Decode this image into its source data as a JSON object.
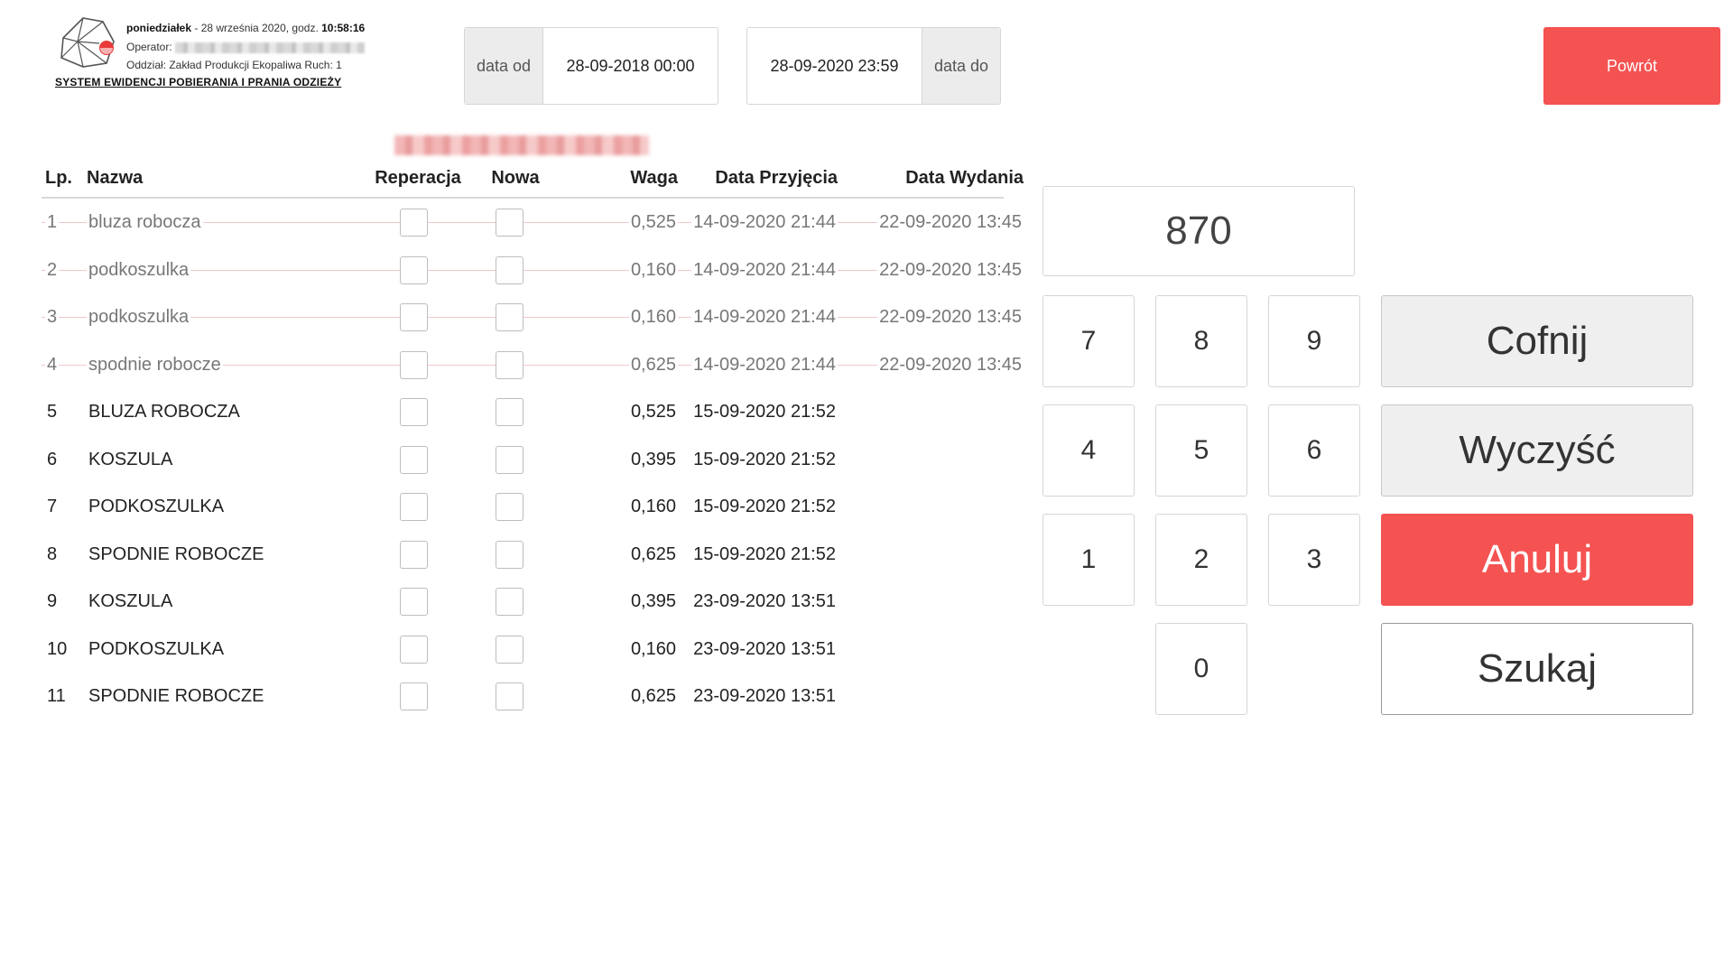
{
  "header": {
    "day": "poniedziałek",
    "date_text": " - 28 września 2020, godz. ",
    "time": "10:58:16",
    "operator_label": "Operator:",
    "branch_text": "Oddział: Zakład Produkcji Ekopaliwa Ruch: 1",
    "system_title": "SYSTEM EWIDENCJI POBIERANIA I PRANIA ODZIEŻY"
  },
  "filters": {
    "from_label": "data od",
    "from_value": "28-09-2018 00:00",
    "to_value": "28-09-2020 23:59",
    "to_label": "data do"
  },
  "back_button": "Powrót",
  "table": {
    "headers": {
      "lp": "Lp.",
      "name": "Nazwa",
      "repair": "Reperacja",
      "new": "Nowa",
      "weight": "Waga",
      "received": "Data Przyjęcia",
      "issued": "Data Wydania"
    },
    "rows": [
      {
        "lp": "1",
        "name": "bluza robocza",
        "weight": "0,525",
        "received": "14-09-2020 21:44",
        "issued": "22-09-2020 13:45"
      },
      {
        "lp": "2",
        "name": "podkoszulka",
        "weight": "0,160",
        "received": "14-09-2020 21:44",
        "issued": "22-09-2020 13:45"
      },
      {
        "lp": "3",
        "name": "podkoszulka",
        "weight": "0,160",
        "received": "14-09-2020 21:44",
        "issued": "22-09-2020 13:45"
      },
      {
        "lp": "4",
        "name": "spodnie robocze",
        "weight": "0,625",
        "received": "14-09-2020 21:44",
        "issued": "22-09-2020 13:45"
      },
      {
        "lp": "5",
        "name": "BLUZA ROBOCZA",
        "weight": "0,525",
        "received": "15-09-2020 21:52",
        "issued": ""
      },
      {
        "lp": "6",
        "name": "KOSZULA",
        "weight": "0,395",
        "received": "15-09-2020 21:52",
        "issued": ""
      },
      {
        "lp": "7",
        "name": "PODKOSZULKA",
        "weight": "0,160",
        "received": "15-09-2020 21:52",
        "issued": ""
      },
      {
        "lp": "8",
        "name": "SPODNIE ROBOCZE",
        "weight": "0,625",
        "received": "15-09-2020 21:52",
        "issued": ""
      },
      {
        "lp": "9",
        "name": "KOSZULA",
        "weight": "0,395",
        "received": "23-09-2020 13:51",
        "issued": ""
      },
      {
        "lp": "10",
        "name": "PODKOSZULKA",
        "weight": "0,160",
        "received": "23-09-2020 13:51",
        "issued": ""
      },
      {
        "lp": "11",
        "name": "SPODNIE ROBOCZE",
        "weight": "0,625",
        "received": "23-09-2020 13:51",
        "issued": ""
      }
    ]
  },
  "keypad": {
    "display": "870",
    "keys": [
      "7",
      "8",
      "9",
      "4",
      "5",
      "6",
      "1",
      "2",
      "3",
      "0"
    ],
    "undo": "Cofnij",
    "clear": "Wyczyść",
    "cancel": "Anuluj",
    "search": "Szukaj"
  },
  "colors": {
    "accent_red": "#f55252",
    "button_gray": "#efefef"
  },
  "icons": {
    "logo": "polyhedron-logo-icon"
  }
}
